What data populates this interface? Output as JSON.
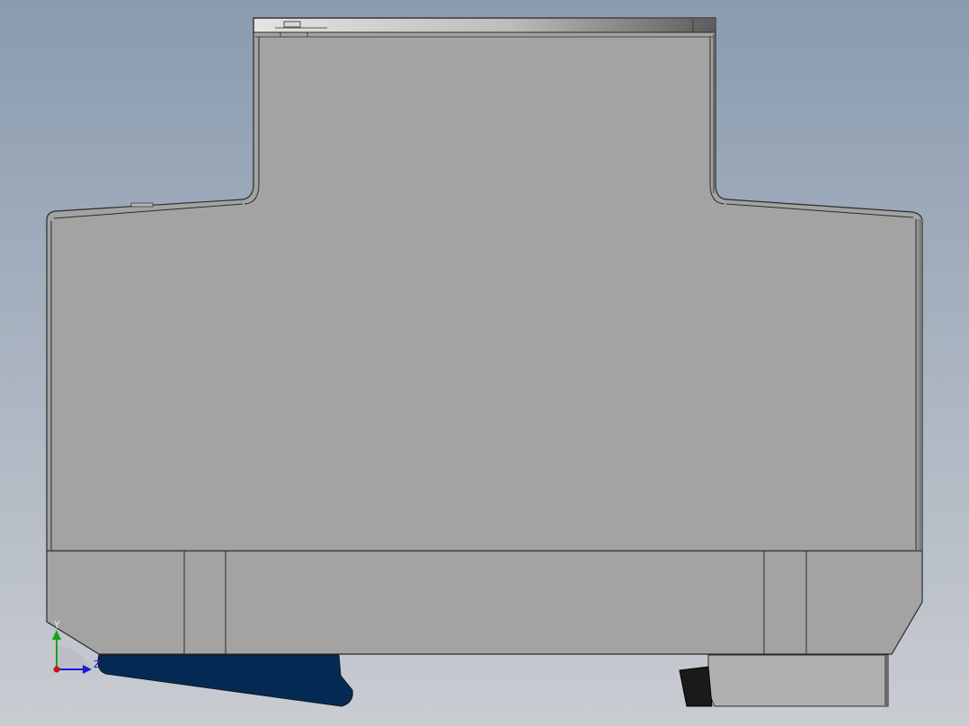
{
  "viewport": {
    "background_top_color": "#8a9bb0",
    "background_bottom_color": "#c9ccd1",
    "body_color": "#a3a3a3",
    "edge_color": "#2b2b2b",
    "clip_color": "#042a54",
    "foot_color": "#b0b0b0",
    "dark_part_color": "#1a1a1a"
  },
  "triad": {
    "y_label": "Y",
    "z_label": "Z",
    "y_axis_color": "#1aa11a",
    "z_axis_color": "#1a1ad0",
    "origin_color": "#c81414"
  }
}
